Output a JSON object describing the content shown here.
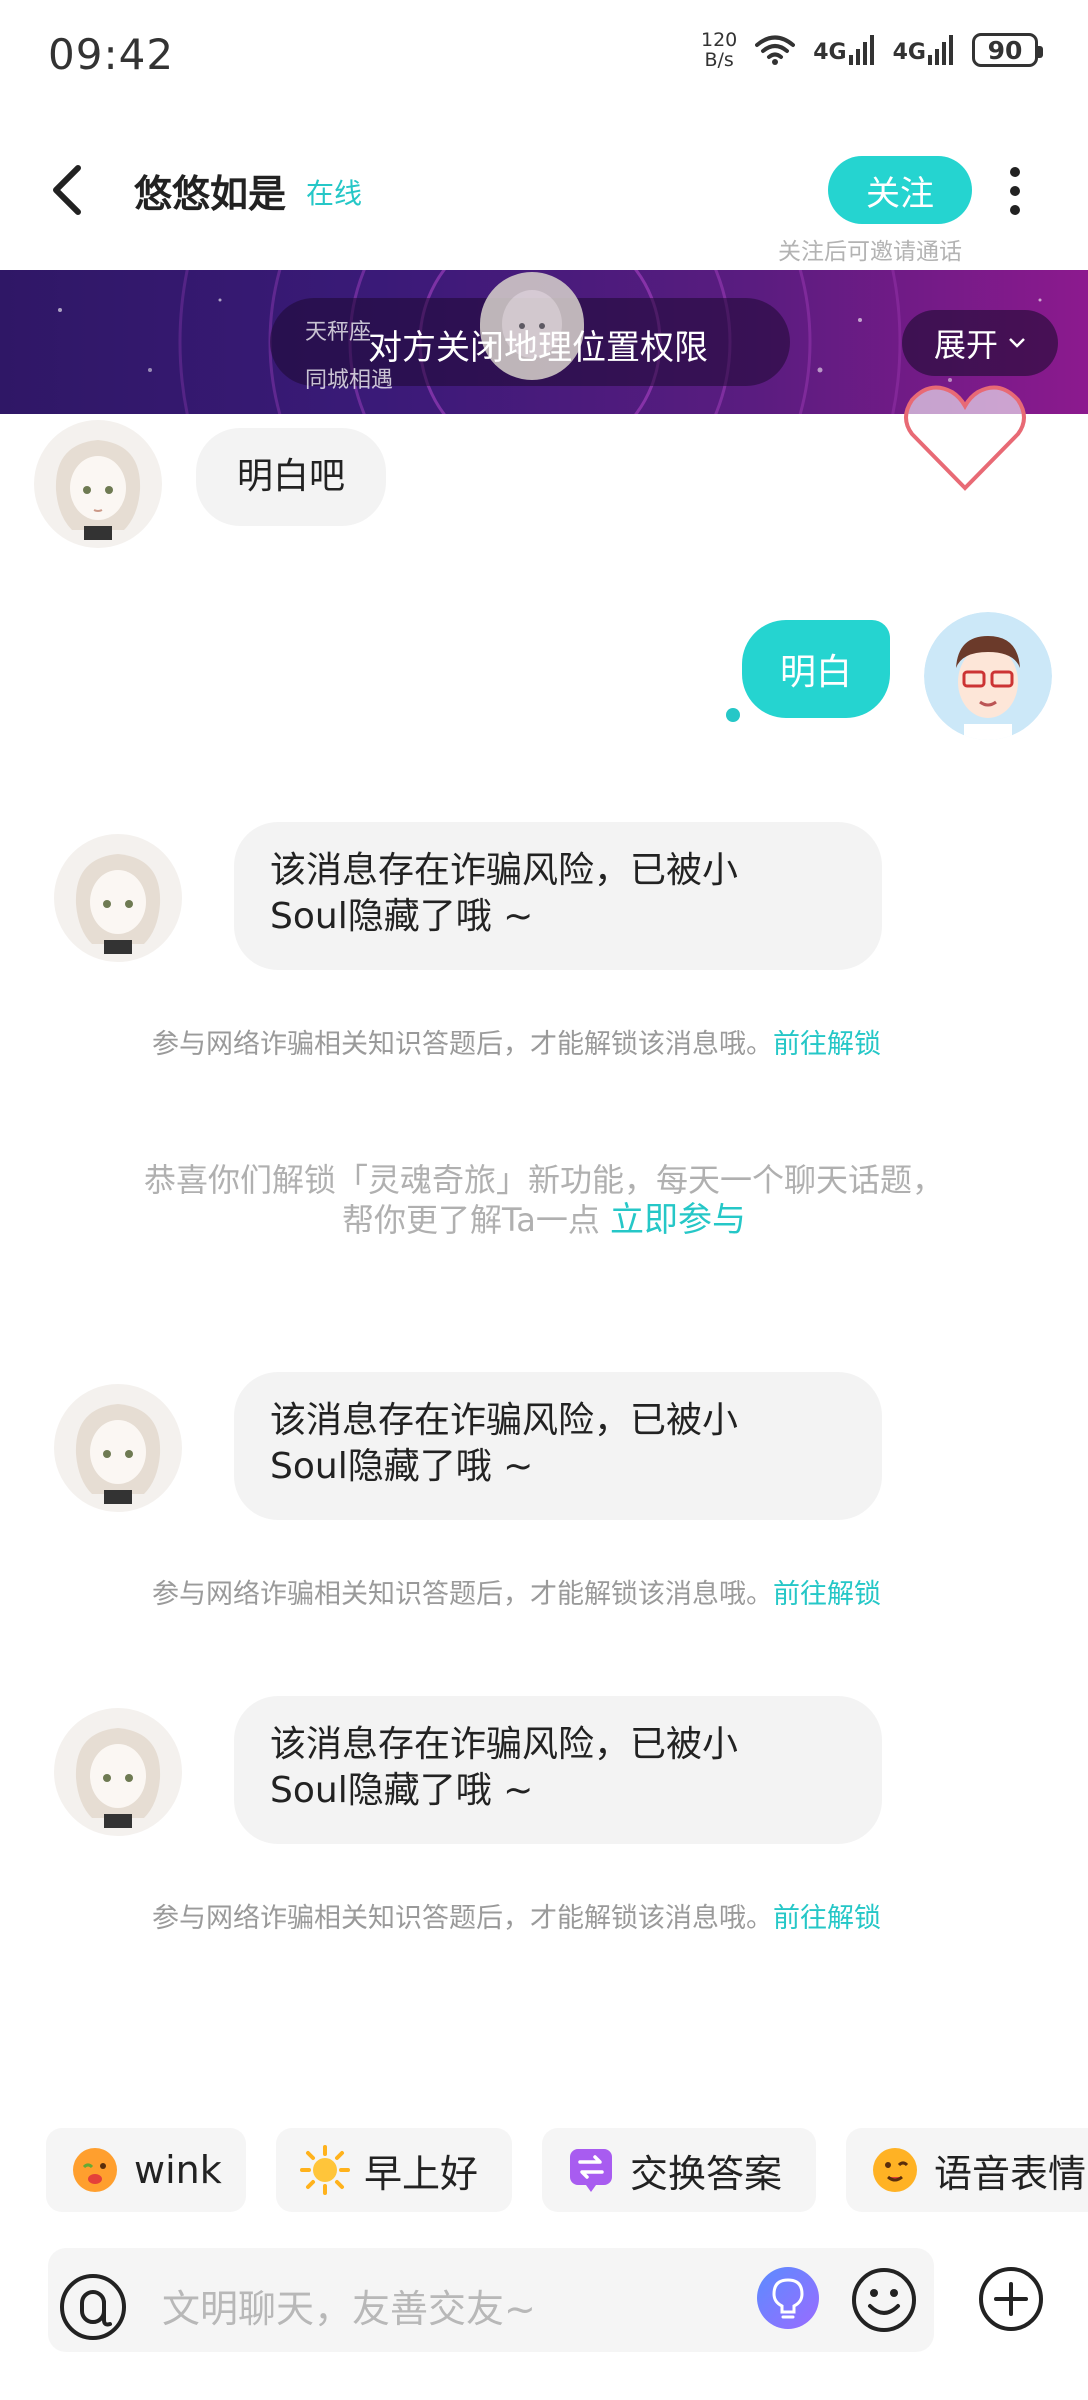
{
  "status_bar": {
    "time": "09:42",
    "speed_value": "120",
    "speed_unit": "B/s",
    "net1": "4G",
    "net2": "4G",
    "battery": "90"
  },
  "header": {
    "title": "悠悠如是",
    "online_status": "在线",
    "follow_label": "关注",
    "follow_hint": "关注后可邀请通话"
  },
  "banner": {
    "zodiac": "天秤座",
    "same_city": "同城相遇",
    "main_text": "对方关闭地理位置权限",
    "expand_label": "展开"
  },
  "messages": {
    "m1_text": "明白吧",
    "m2_text": "明白",
    "fraud_line1": "该消息存在诈骗风险，已被小",
    "fraud_line2": "Soul隐藏了哦 ~",
    "fraud_note": "参与网络诈骗相关知识答题后，才能解锁该消息哦。",
    "fraud_link": "前往解锁",
    "system_line1": "恭喜你们解锁「灵魂奇旅」新功能，每天一个聊天话题，",
    "system_line2": "帮你更了解Ta一点",
    "system_link": "立即参与"
  },
  "chips": [
    {
      "label": "wink",
      "icon": "wink-emoji-icon"
    },
    {
      "label": "早上好",
      "icon": "sun-icon"
    },
    {
      "label": "交换答案",
      "icon": "exchange-icon"
    },
    {
      "label": "语音表情",
      "icon": "voice-emoji-icon"
    }
  ],
  "input": {
    "placeholder": "文明聊天，友善交友~"
  },
  "colors": {
    "accent": "#25d4d0",
    "link": "#25c7c7",
    "bubble_bg": "#f3f3f3"
  }
}
